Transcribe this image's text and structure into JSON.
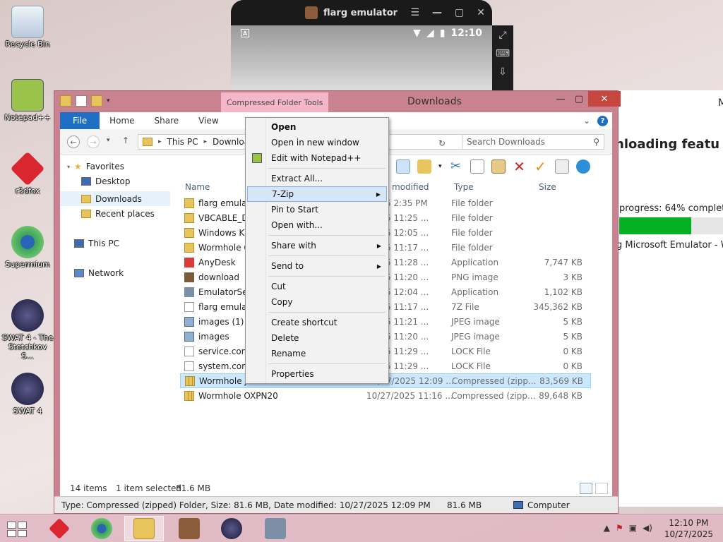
{
  "desktop": {
    "icons": [
      {
        "label": "Recycle Bin"
      },
      {
        "label": "Notepad++"
      },
      {
        "label": "r3dfox"
      },
      {
        "label": "Supermium"
      },
      {
        "label": "SWAT 4 - The Stetchkov S..."
      },
      {
        "label": "SWAT 4"
      }
    ]
  },
  "emulator": {
    "title": "flarg emulator",
    "status_letter": "A",
    "time": "12:10"
  },
  "background_window": {
    "heading": "nloading featu",
    "right_top": "M",
    "progress_text": "progress: 64% complete",
    "progress_fraction": 0.64,
    "line": "g Microsoft Emulator - W"
  },
  "explorer": {
    "title": "Downloads",
    "context_tab": "Compressed Folder Tools",
    "ribbon_tabs": {
      "file": "File",
      "home": "Home",
      "share": "Share",
      "view": "View"
    },
    "address": {
      "this_pc": "This PC",
      "current": "Download"
    },
    "search_placeholder": "Search Downloads",
    "nav": {
      "favorites": "Favorites",
      "desktop": "Desktop",
      "downloads": "Downloads",
      "recent": "Recent places",
      "this_pc": "This PC",
      "network": "Network"
    },
    "columns": {
      "name": "Name",
      "date": "modified",
      "type": "Type",
      "size": "Size"
    },
    "files": [
      {
        "name": "flarg emulato",
        "date": "/2025 2:35 PM",
        "type": "File folder",
        "size": "",
        "icon": "folder"
      },
      {
        "name": "VBCABLE_Dr",
        "date": "/2025 11:25 ...",
        "type": "File folder",
        "size": "",
        "icon": "folder"
      },
      {
        "name": "Windows Kit",
        "date": "/2025 12:05 ...",
        "type": "File folder",
        "size": "",
        "icon": "folder"
      },
      {
        "name": "Wormhole O",
        "date": "/2025 11:17 ...",
        "type": "File folder",
        "size": "",
        "icon": "folder"
      },
      {
        "name": "AnyDesk",
        "date": "/2025 11:28 ...",
        "type": "Application",
        "size": "7,747 KB",
        "icon": "app"
      },
      {
        "name": "download",
        "date": "/2025 11:20 ...",
        "type": "PNG image",
        "size": "3 KB",
        "icon": "png"
      },
      {
        "name": "EmulatorSeti",
        "date": "/2025 12:04 ...",
        "type": "Application",
        "size": "1,102 KB",
        "icon": "exe"
      },
      {
        "name": "flarg emulato",
        "date": "/2025 11:17 ...",
        "type": "7Z File",
        "size": "345,362 KB",
        "icon": "file"
      },
      {
        "name": "images (1)",
        "date": "/2025 11:21 ...",
        "type": "JPEG image",
        "size": "5 KB",
        "icon": "img"
      },
      {
        "name": "images",
        "date": "/2025 11:20 ...",
        "type": "JPEG image",
        "size": "5 KB",
        "icon": "img"
      },
      {
        "name": "service.conf.",
        "date": "/2025 11:29 ...",
        "type": "LOCK File",
        "size": "0 KB",
        "icon": "file"
      },
      {
        "name": "system.conf.",
        "date": "/2025 11:29 ...",
        "type": "LOCK File",
        "size": "0 KB",
        "icon": "file"
      },
      {
        "name": "Wormhole JEN39k",
        "date": "10/27/2025 12:09 ...",
        "type": "Compressed (zipp...",
        "size": "83,569 KB",
        "icon": "zip",
        "selected": true
      },
      {
        "name": "Wormhole OXPN20",
        "date": "10/27/2025 11:16 ...",
        "type": "Compressed (zipp...",
        "size": "89,648 KB",
        "icon": "zip"
      }
    ],
    "status": {
      "items": "14 items",
      "selected": "1 item selected",
      "size": "81.6 MB"
    },
    "details_bar": {
      "text": "Type: Compressed (zipped) Folder, Size: 81.6 MB, Date modified: 10/27/2025 12:09 PM",
      "size": "81.6 MB",
      "location": "Computer"
    }
  },
  "context_menu": {
    "open": "Open",
    "open_new": "Open in new window",
    "edit_np": "Edit with Notepad++",
    "extract": "Extract All...",
    "sevenzip": "7-Zip",
    "pin": "Pin to Start",
    "open_with": "Open with...",
    "share_with": "Share with",
    "send_to": "Send to",
    "cut": "Cut",
    "copy": "Copy",
    "create_shortcut": "Create shortcut",
    "delete": "Delete",
    "rename": "Rename",
    "properties": "Properties"
  },
  "taskbar": {
    "time": "12:10 PM",
    "date": "10/27/2025"
  }
}
